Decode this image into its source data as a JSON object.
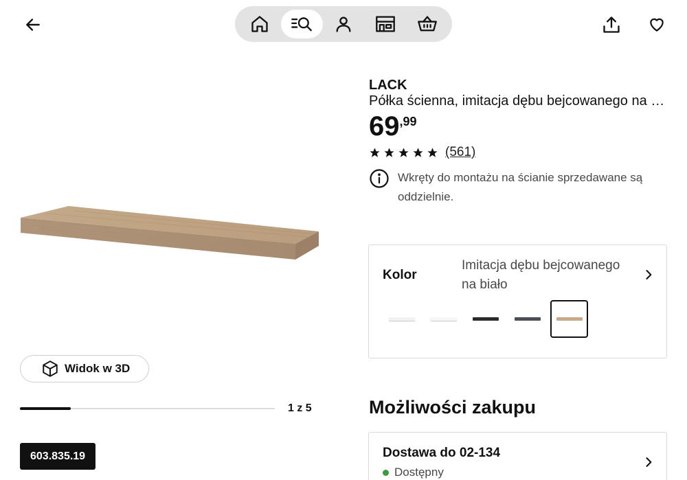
{
  "header": {
    "nav_items": [
      "home-icon",
      "search-list-icon",
      "profile-icon",
      "store-icon",
      "basket-icon"
    ],
    "active_nav": "search-list-icon"
  },
  "gallery": {
    "view_3d_label": "Widok w 3D",
    "page_counter": "1 z 5",
    "current_image": 1,
    "total_images": 5,
    "article_number": "603.835.19"
  },
  "product": {
    "name": "LACK",
    "description": "Półka ścienna, imitacja dębu bejcowanego na biało",
    "price_main": "69",
    "price_decimal": ",99",
    "rating_stars": 5,
    "review_count": "(561)",
    "notice": "Wkręty do montażu na ścianie sprzedawane są oddzielnie."
  },
  "color": {
    "label": "Kolor",
    "value": "Imitacja dębu bejcowanego na biało",
    "swatches": [
      {
        "name": "white",
        "color": "#f2f2f2"
      },
      {
        "name": "white-2",
        "color": "#f6f6f6"
      },
      {
        "name": "black-brown",
        "color": "#2b2b2b"
      },
      {
        "name": "dark-grey",
        "color": "#4a4f57"
      },
      {
        "name": "white-stained-oak",
        "color": "#c9a987"
      }
    ],
    "selected_index": 4
  },
  "purchase": {
    "section_title": "Możliwości zakupu",
    "delivery_title": "Dostawa do 02-134",
    "delivery_status": "Dostępny",
    "status_color": "#3b9a3b"
  }
}
